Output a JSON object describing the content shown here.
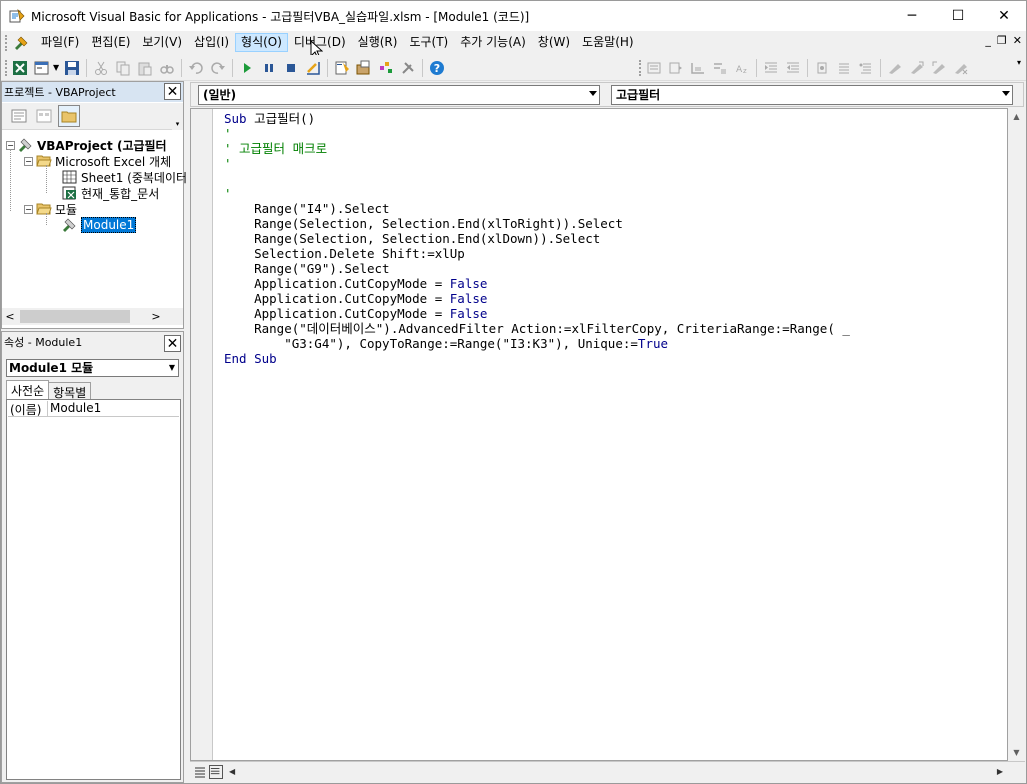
{
  "window": {
    "title": "Microsoft Visual Basic for Applications - 고급필터VBA_실습파일.xlsm - [Module1 (코드)]",
    "minimize": "─",
    "maximize": "☐",
    "close": "✕"
  },
  "menu": {
    "items": [
      "파일(F)",
      "편집(E)",
      "보기(V)",
      "삽입(I)",
      "형식(O)",
      "디버그(D)",
      "실행(R)",
      "도구(T)",
      "추가 기능(A)",
      "창(W)",
      "도움말(H)"
    ],
    "hovered": "형식(O)",
    "mdi_min": "_",
    "mdi_restore": "❐",
    "mdi_close": "✕"
  },
  "toolbar": {
    "icons": [
      "excel-icon",
      "insert-userform-icon",
      "save-icon",
      "cut-icon",
      "copy-icon",
      "paste-icon",
      "find-icon",
      "undo-icon",
      "redo-icon",
      "run-icon",
      "break-icon",
      "reset-icon",
      "design-mode-icon",
      "project-explorer-icon",
      "properties-icon",
      "object-browser-icon",
      "toolbox-icon",
      "help-icon"
    ]
  },
  "project_pane": {
    "title": "프로젝트 - VBAProject",
    "close": "✕",
    "tree": [
      {
        "label": "VBAProject (고급필터",
        "level": 0,
        "expander": "−",
        "bold": true
      },
      {
        "label": "Microsoft Excel 개체",
        "level": 1,
        "expander": "−"
      },
      {
        "label": "Sheet1 (중복데이터",
        "level": 2
      },
      {
        "label": "현재_통합_문서",
        "level": 2
      },
      {
        "label": "모듈",
        "level": 1,
        "expander": "−"
      },
      {
        "label": "Module1",
        "level": 2,
        "selected": true
      }
    ],
    "scroll_left": "<",
    "scroll_right": ">"
  },
  "properties_pane": {
    "title": "속성 - Module1",
    "close": "✕",
    "object_combo": "Module1 모듈",
    "tabs": [
      "사전순",
      "항목별"
    ],
    "rows": [
      {
        "name": "(이름)",
        "value": "Module1"
      }
    ]
  },
  "code_window": {
    "object_combo": "(일반)",
    "procedure_combo": "고급필터",
    "lines": [
      [
        {
          "t": "Sub",
          "c": "kw"
        },
        {
          "t": " 고급필터()",
          "c": ""
        }
      ],
      [
        {
          "t": "'",
          "c": "cm"
        }
      ],
      [
        {
          "t": "' 고급필터 매크로",
          "c": "cm"
        }
      ],
      [
        {
          "t": "'",
          "c": "cm"
        }
      ],
      [
        {
          "t": "",
          "c": ""
        }
      ],
      [
        {
          "t": "'",
          "c": "cm"
        }
      ],
      [
        {
          "t": "    Range(\"I4\").Select",
          "c": ""
        }
      ],
      [
        {
          "t": "    Range(Selection, Selection.End(xlToRight)).Select",
          "c": ""
        }
      ],
      [
        {
          "t": "    Range(Selection, Selection.End(xlDown)).Select",
          "c": ""
        }
      ],
      [
        {
          "t": "    Selection.Delete Shift:=xlUp",
          "c": ""
        }
      ],
      [
        {
          "t": "    Range(\"G9\").Select",
          "c": ""
        }
      ],
      [
        {
          "t": "    Application.CutCopyMode = ",
          "c": ""
        },
        {
          "t": "False",
          "c": "kw"
        }
      ],
      [
        {
          "t": "    Application.CutCopyMode = ",
          "c": ""
        },
        {
          "t": "False",
          "c": "kw"
        }
      ],
      [
        {
          "t": "    Application.CutCopyMode = ",
          "c": ""
        },
        {
          "t": "False",
          "c": "kw"
        }
      ],
      [
        {
          "t": "    Range(\"데이터베이스\").AdvancedFilter Action:=xlFilterCopy, CriteriaRange:=Range( _",
          "c": ""
        }
      ],
      [
        {
          "t": "        \"G3:G4\"), CopyToRange:=Range(\"I3:K3\"), Unique:=",
          "c": ""
        },
        {
          "t": "True",
          "c": "kw"
        }
      ],
      [
        {
          "t": "End Sub",
          "c": "kw"
        }
      ]
    ]
  },
  "colors": {
    "keyword": "#00008b",
    "comment": "#008000",
    "selection": "#0078d7",
    "pane_title": "#d7e4f2"
  }
}
